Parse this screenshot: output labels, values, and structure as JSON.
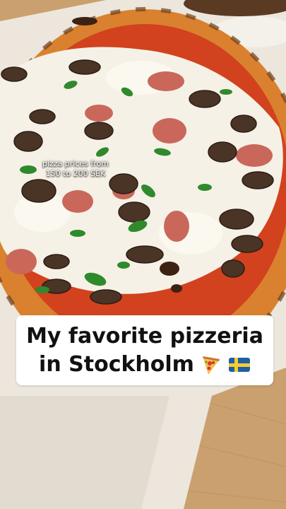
{
  "overlay": {
    "price_line_1": "pizza prices from",
    "price_line_2": "150 to 200 SEK"
  },
  "caption": {
    "line_1": "My favorite pizzeria",
    "line_2": "in Stockholm"
  },
  "icons": {
    "pizza": "pizza-emoji-icon",
    "flag": "sweden-flag-icon"
  },
  "colors": {
    "crust": "#d9812f",
    "cheese": "#f6f1e6",
    "tomato": "#d2421e",
    "mushroom": "#4a3426",
    "herb": "#2f8a2c",
    "caption_bg": "#ffffff",
    "caption_text": "#111111"
  }
}
